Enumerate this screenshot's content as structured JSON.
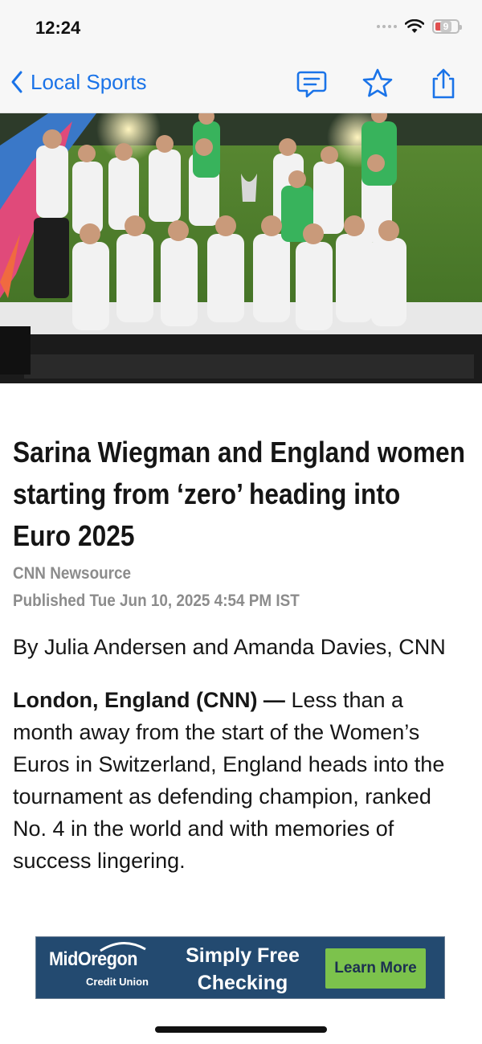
{
  "status_bar": {
    "time": "12:24",
    "battery": "9"
  },
  "nav": {
    "back_label": "Local Sports"
  },
  "article": {
    "headline": "Sarina Wiegman and England women starting from ‘zero’ heading into Euro 2025",
    "source": "CNN Newsource",
    "published": "Published Tue Jun 10, 2025 4:54 PM IST",
    "byline": "By Julia Andersen and Amanda Davies, CNN",
    "lead": "London, England (CNN) —",
    "body": " Less than a month away from the start of the Women’s Euros in Switzerland, England heads into the tournament as defending champion, ranked No. 4 in the world and with memories of success lingering."
  },
  "ad": {
    "brand": "MidOregon",
    "brand_sub": "Credit Union",
    "headline": "Simply Free Checking",
    "cta": "Learn More"
  },
  "colors": {
    "accent": "#1a73e8",
    "ad_bg": "#234a70",
    "ad_button": "#7cc24c"
  }
}
